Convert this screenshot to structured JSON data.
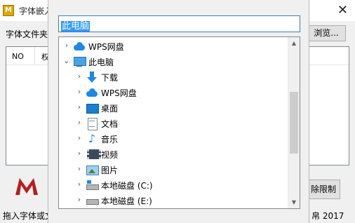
{
  "background_app": {
    "title": "字体嵌入",
    "close_glyph": "✕",
    "font_folder_label": "字体文件夹",
    "browse_label": "浏览...",
    "columns": [
      "NO",
      "权"
    ],
    "limit_button": "除限制",
    "status_left": "拖入字体或文",
    "status_right": "帛 2017"
  },
  "dialog": {
    "path_value": "此电脑",
    "tree": [
      {
        "label": "WPS网盘",
        "icon": "cloud-icon",
        "expander": "›",
        "level": 0
      },
      {
        "label": "此电脑",
        "icon": "computer-icon",
        "expander": "⌄",
        "level": 0
      },
      {
        "label": "下载",
        "icon": "download-icon",
        "expander": "›",
        "level": 1
      },
      {
        "label": "WPS网盘",
        "icon": "cloud-icon",
        "expander": "›",
        "level": 1
      },
      {
        "label": "桌面",
        "icon": "desktop-icon",
        "expander": "›",
        "level": 1
      },
      {
        "label": "文档",
        "icon": "document-icon",
        "expander": "›",
        "level": 1
      },
      {
        "label": "音乐",
        "icon": "music-icon",
        "expander": "›",
        "level": 1
      },
      {
        "label": "视频",
        "icon": "video-icon",
        "expander": "›",
        "level": 1
      },
      {
        "label": "图片",
        "icon": "picture-icon",
        "expander": "›",
        "level": 1
      },
      {
        "label": "本地磁盘 (C:)",
        "icon": "drive-c-icon",
        "expander": "›",
        "level": 1
      },
      {
        "label": "本地磁盘 (E:)",
        "icon": "drive-e-icon",
        "expander": "›",
        "level": 1
      }
    ]
  },
  "colors": {
    "selection": "#3399ff",
    "accent_blue": "#1e88e5"
  }
}
